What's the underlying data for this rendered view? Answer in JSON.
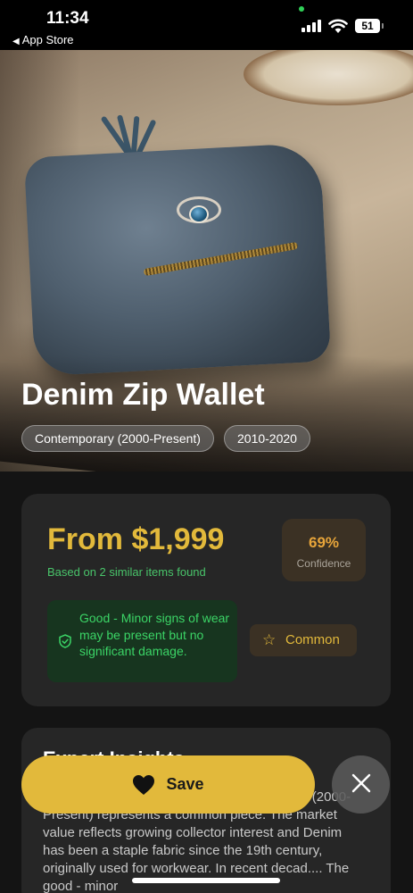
{
  "status_bar": {
    "time": "11:34",
    "back_label": "App Store",
    "battery": "51",
    "icons": [
      "signal-icon",
      "wifi-icon",
      "battery-icon"
    ]
  },
  "item": {
    "title": "Denim Zip Wallet",
    "tags": [
      "Contemporary (2000-Present)",
      "2010-2020"
    ]
  },
  "pricing": {
    "price": "From $1,999",
    "basis": "Based on 2 similar items found",
    "confidence_value": "69%",
    "confidence_label": "Confidence",
    "condition": "Good - Minor signs of wear may be present but no significant damage.",
    "rarity": "Common"
  },
  "description": {
    "heading": "Expert Insights",
    "text": "This denim zip wallet from the Contemporary (2000-Present) represents a common piece. The market value reflects growing collector interest and Denim has been a staple fabric since the 19th century, originally used for workwear. In recent decad.... The good - minor"
  },
  "actions": {
    "save_label": "Save"
  },
  "colors": {
    "accent": "#e2b93b",
    "success": "#3bd466",
    "background": "#141414",
    "card": "#262626"
  }
}
